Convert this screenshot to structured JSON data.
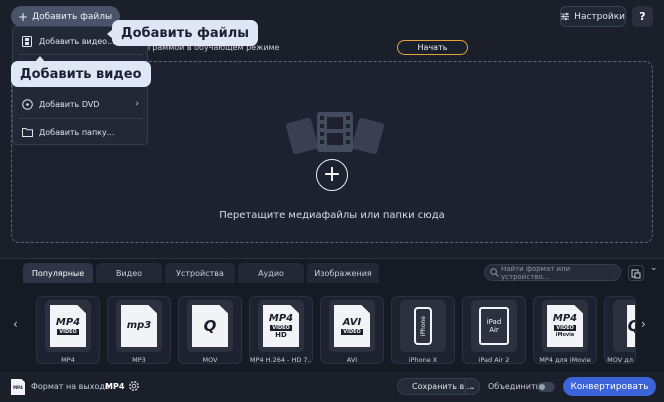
{
  "header": {
    "add_files_label": "Добавить файлы",
    "settings_label": "Настройки",
    "help_label": "?"
  },
  "tutorial": {
    "text": "граммой в обучающем режиме",
    "start_label": "Начать"
  },
  "dropzone": {
    "hint": "Перетащите медиафайлы или папки сюда"
  },
  "add_menu": {
    "items": [
      {
        "label": "Добавить видео...",
        "icon": "film-icon"
      },
      {
        "label": "Добавить DVD",
        "icon": "dvd-icon",
        "arrow": "›"
      },
      {
        "label": "Добавить папку...",
        "icon": "folder-icon"
      }
    ]
  },
  "tooltips": {
    "add_files": "Добавить файлы",
    "add_video": "Добавить видео"
  },
  "formats": {
    "tabs": [
      "Популярные",
      "Видео",
      "Устройства",
      "Аудио",
      "Изображения"
    ],
    "active_tab": "Популярные",
    "search_placeholder": "Найти формат или устройство...",
    "items": [
      {
        "name": "MP4",
        "big": "MP4",
        "sub": "VIDEO"
      },
      {
        "name": "MP3",
        "big": "mp3",
        "sub": ""
      },
      {
        "name": "MOV",
        "big": "Q",
        "sub": ""
      },
      {
        "name": "MP4 H.264 - HD 7...",
        "big": "MP4",
        "sub": "VIDEO",
        "extra": "HD"
      },
      {
        "name": "AVI",
        "big": "AVI",
        "sub": "VIDEO"
      },
      {
        "name": "iPhone X",
        "big": "iPhone",
        "sub": ""
      },
      {
        "name": "iPad Air 2",
        "big": "iPad",
        "sub": "Air"
      },
      {
        "name": "MP4 для iMovie",
        "big": "MP4",
        "sub": "VIDEO",
        "extra": "iMovie"
      },
      {
        "name": "MOV дл",
        "big": "Q",
        "sub": ""
      }
    ],
    "prev_arrow": "‹",
    "next_arrow": "›",
    "collapse": "⌄"
  },
  "bottom": {
    "format_icon_text": "MP4",
    "output_label": "Формат на выходе:",
    "output_value": "MP4",
    "save_label": "Сохранить в...",
    "save_chevron": "⌄",
    "merge_label": "Объединить:",
    "convert_label": "Конвертировать"
  },
  "colors": {
    "background": "#1b1f2a",
    "accent": "#3c63d8",
    "start_border": "#e4a23c",
    "tooltip": "#dfe7f6"
  }
}
